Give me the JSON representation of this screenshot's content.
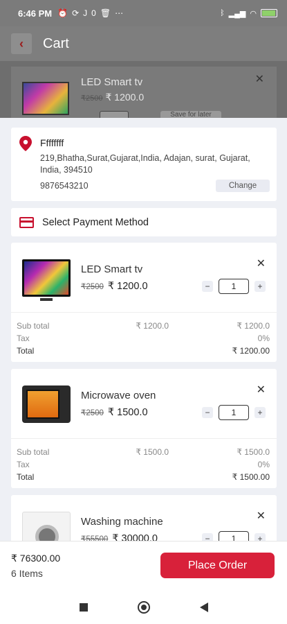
{
  "status_bar": {
    "time": "6:46 PM",
    "icons_left": [
      "alarm-icon",
      "sync-icon",
      "jio-icon",
      "trash-icon",
      "more-icon"
    ],
    "icons_right": [
      "bluetooth-icon",
      "signal-icon",
      "wifi-icon",
      "battery-icon"
    ],
    "jio_label": "J0"
  },
  "header": {
    "title": "Cart",
    "back_icon": "back-arrow-icon"
  },
  "background_item": {
    "name": "LED Smart tv",
    "old_price": "₹2500",
    "price": "₹ 1200.0",
    "save_label": "Save for later"
  },
  "address": {
    "name": "Ffffffff",
    "line": "219,Bhatha,Surat,Gujarat,India, Adajan, surat, Gujarat, India, 394510",
    "phone": "9876543210",
    "change_label": "Change"
  },
  "payment": {
    "label": "Select Payment Method"
  },
  "items": [
    {
      "name": "LED Smart tv",
      "old_price": "₹2500",
      "price": "₹ 1200.0",
      "qty": "1",
      "sub_total_label": "Sub total",
      "sub_total_mid": "₹ 1200.0",
      "sub_total": "₹ 1200.0",
      "tax_label": "Tax",
      "tax": "0%",
      "total_label": "Total",
      "total": "₹ 1200.00"
    },
    {
      "name": "Microwave oven",
      "old_price": "₹2500",
      "price": "₹ 1500.0",
      "qty": "1",
      "sub_total_label": "Sub total",
      "sub_total_mid": "₹ 1500.0",
      "sub_total": "₹ 1500.0",
      "tax_label": "Tax",
      "tax": "0%",
      "total_label": "Total",
      "total": "₹ 1500.00"
    },
    {
      "name": "Washing machine",
      "old_price": "₹55500",
      "price": "₹ 30000.0",
      "qty": "1"
    }
  ],
  "footer": {
    "amount": "₹ 76300.00",
    "count": "6 Items",
    "place_order": "Place Order"
  },
  "colors": {
    "accent": "#d8213a",
    "pin": "#c8102e"
  }
}
